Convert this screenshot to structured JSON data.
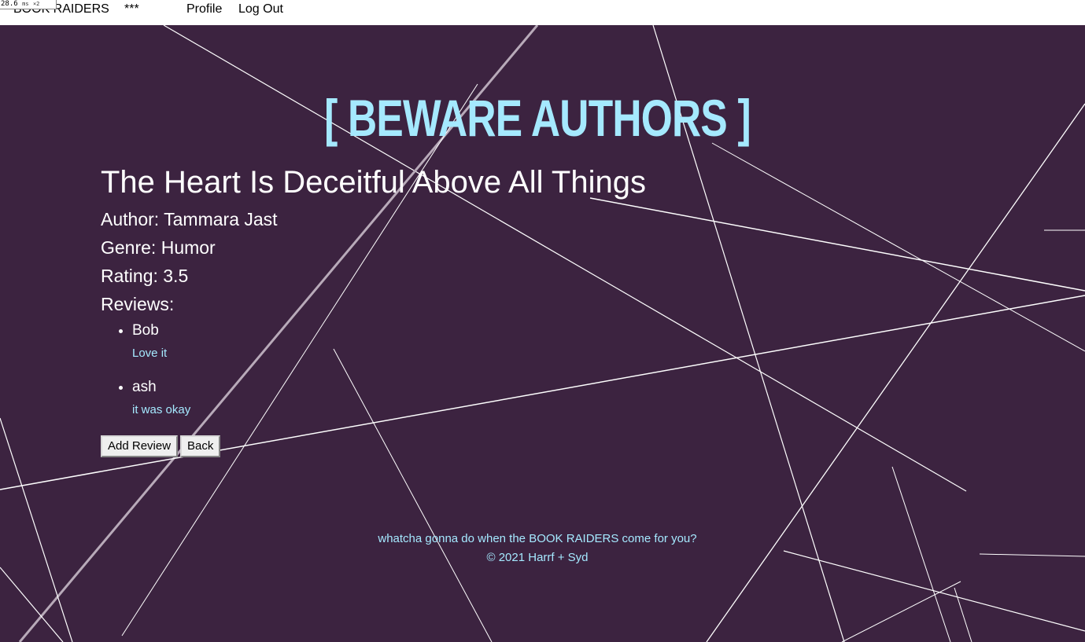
{
  "fps_badge": {
    "value": "28.6",
    "unit": "ms",
    "multiplier": "×2"
  },
  "nav": {
    "brand": "BOOK RAIDERS",
    "stars": "***",
    "profile": "Profile",
    "logout": "Log Out"
  },
  "site_title": "[ BEWARE AUTHORS ]",
  "book": {
    "title": "The Heart Is Deceitful Above All Things",
    "author_line": "Author: Tammara Jast",
    "genre_line": "Genre: Humor",
    "rating_line": "Rating: 3.5",
    "reviews_heading": "Reviews:"
  },
  "reviews": [
    {
      "author": "Bob",
      "text": "Love it"
    },
    {
      "author": "ash",
      "text": "it was okay"
    }
  ],
  "buttons": {
    "add_review": "Add Review",
    "back": "Back"
  },
  "footer": {
    "tagline": "whatcha gonna do when the BOOK RAIDERS come for you?",
    "copyright": "© 2021 Harrf + Syd"
  },
  "colors": {
    "background": "#3c2340",
    "accent": "#a5e9ff",
    "text": "#ffffff",
    "lines": "#ffffff"
  }
}
